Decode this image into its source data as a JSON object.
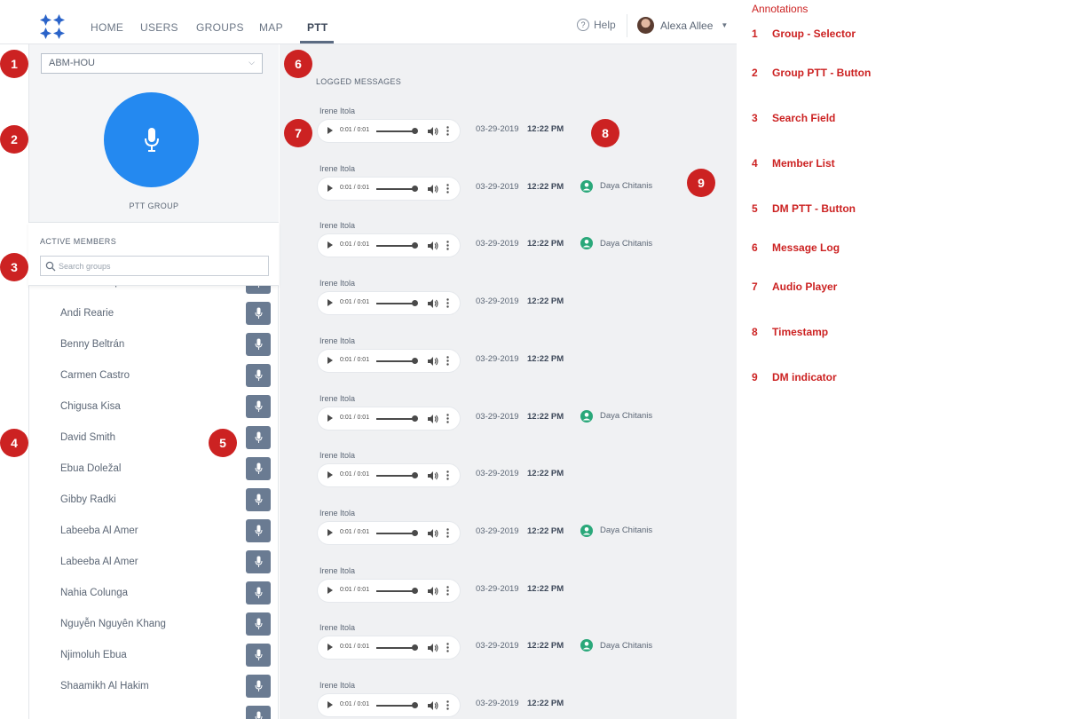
{
  "nav": {
    "tabs": [
      {
        "label": "HOME"
      },
      {
        "label": "USERS"
      },
      {
        "label": "GROUPS"
      },
      {
        "label": "MAP"
      },
      {
        "label": "PTT",
        "active": true
      }
    ],
    "help": "Help",
    "user_name": "Alexa Allee"
  },
  "left_panel": {
    "group_selector_value": "ABM-HOU",
    "ptt_label": "PTT GROUP",
    "members_title": "ACTIVE MEMBERS",
    "search_placeholder": "Search groups",
    "members": [
      "Aromita Haque",
      "Andi Rearie",
      "Benny Beltrán",
      "Carmen Castro",
      "Chigusa Kisa",
      "David Smith",
      "Ebua Doležal",
      "Gibby Radki",
      "Labeeba Al Amer",
      "Labeeba Al Amer",
      "Nahia Colunga",
      "Nguyễn Nguyên Khang",
      "Njimoluh Ebua",
      "Shaamikh Al Hakim",
      ""
    ]
  },
  "log": {
    "title": "LOGGED MESSAGES",
    "messages": [
      {
        "sender": "Irene Itola",
        "player_time": "0:01 / 0:01",
        "date": "03-29-2019",
        "time": "12:22 PM",
        "dm": ""
      },
      {
        "sender": "Irene Itola",
        "player_time": "0:01 / 0:01",
        "date": "03-29-2019",
        "time": "12:22 PM",
        "dm": "Daya Chitanis"
      },
      {
        "sender": "Irene Itola",
        "player_time": "0:01 / 0:01",
        "date": "03-29-2019",
        "time": "12:22 PM",
        "dm": "Daya Chitanis"
      },
      {
        "sender": "Irene Itola",
        "player_time": "0:01 / 0:01",
        "date": "03-29-2019",
        "time": "12:22 PM",
        "dm": ""
      },
      {
        "sender": "Irene Itola",
        "player_time": "0:01 / 0:01",
        "date": "03-29-2019",
        "time": "12:22 PM",
        "dm": ""
      },
      {
        "sender": "Irene Itola",
        "player_time": "0:01 / 0:01",
        "date": "03-29-2019",
        "time": "12:22 PM",
        "dm": "Daya Chitanis"
      },
      {
        "sender": "Irene Itola",
        "player_time": "0:01 / 0:01",
        "date": "03-29-2019",
        "time": "12:22 PM",
        "dm": ""
      },
      {
        "sender": "Irene Itola",
        "player_time": "0:01 / 0:01",
        "date": "03-29-2019",
        "time": "12:22 PM",
        "dm": "Daya Chitanis"
      },
      {
        "sender": "Irene Itola",
        "player_time": "0:01 / 0:01",
        "date": "03-29-2019",
        "time": "12:22 PM",
        "dm": ""
      },
      {
        "sender": "Irene Itola",
        "player_time": "0:01 / 0:01",
        "date": "03-29-2019",
        "time": "12:22 PM",
        "dm": "Daya Chitanis"
      },
      {
        "sender": "Irene Itola",
        "player_time": "0:01 / 0:01",
        "date": "03-29-2019",
        "time": "12:22 PM",
        "dm": ""
      }
    ]
  },
  "badges": [
    "1",
    "2",
    "3",
    "4",
    "5",
    "6",
    "7",
    "8",
    "9"
  ],
  "annotations": {
    "title": "Annotations",
    "items": [
      {
        "num": "1",
        "label": "Group - Selector"
      },
      {
        "num": "2",
        "label": "Group PTT - Button"
      },
      {
        "num": "3",
        "label": "Search Field"
      },
      {
        "num": "4",
        "label": "Member List"
      },
      {
        "num": "5",
        "label": "DM PTT - Button"
      },
      {
        "num": "6",
        "label": "Message Log"
      },
      {
        "num": "7",
        "label": "Audio Player"
      },
      {
        "num": "8",
        "label": "Timestamp"
      },
      {
        "num": "9",
        "label": "DM indicator"
      }
    ]
  },
  "colors": {
    "accent": "#2489f0",
    "annotation": "#cc2222",
    "dm_button": "#6a7b92",
    "dm_indicator": "#2aa87a"
  },
  "icons": {
    "logo": "diamond-cluster-logo",
    "ptt": "microphone-icon",
    "search": "search-icon",
    "dm": "person-circle-icon"
  }
}
